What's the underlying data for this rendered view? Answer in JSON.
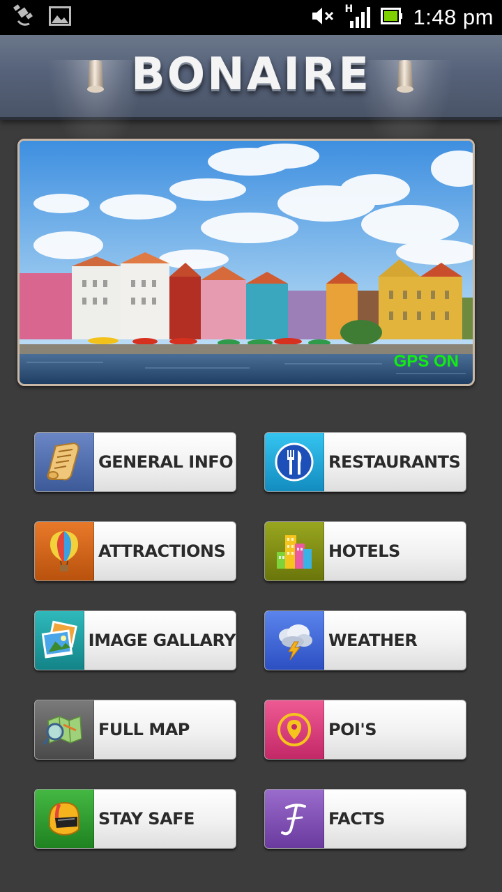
{
  "status_bar": {
    "time": "1:48 pm",
    "icons": [
      "gps-icon",
      "gallery-icon",
      "mute-icon",
      "signal-icon",
      "battery-icon"
    ],
    "network_label": "H"
  },
  "header": {
    "title": "BONAIRE"
  },
  "banner": {
    "gps_status": "GPS ON"
  },
  "menu": {
    "items": [
      {
        "label": "GENERAL INFO",
        "icon": "scroll-icon",
        "color": "#4d6aa8"
      },
      {
        "label": "RESTAURANTS",
        "icon": "fork-knife-icon",
        "color": "#1fa5d8"
      },
      {
        "label": "ATTRACTIONS",
        "icon": "hot-air-balloon-icon",
        "color": "#d0641a"
      },
      {
        "label": "HOTELS",
        "icon": "buildings-icon",
        "color": "#7e8c12"
      },
      {
        "label": "IMAGE GALLARY",
        "icon": "photos-icon",
        "color": "#1c9fa3"
      },
      {
        "label": "WEATHER",
        "icon": "storm-cloud-icon",
        "color": "#3b62d6"
      },
      {
        "label": "FULL MAP",
        "icon": "map-magnifier-icon",
        "color": "#5e5e5e"
      },
      {
        "label": "POI'S",
        "icon": "location-pin-icon",
        "color": "#d93f7c"
      },
      {
        "label": "STAY SAFE",
        "icon": "helmet-icon",
        "color": "#2e9b2d"
      },
      {
        "label": "FACTS",
        "icon": "letter-f-icon",
        "color": "#7d4fb0"
      }
    ]
  }
}
